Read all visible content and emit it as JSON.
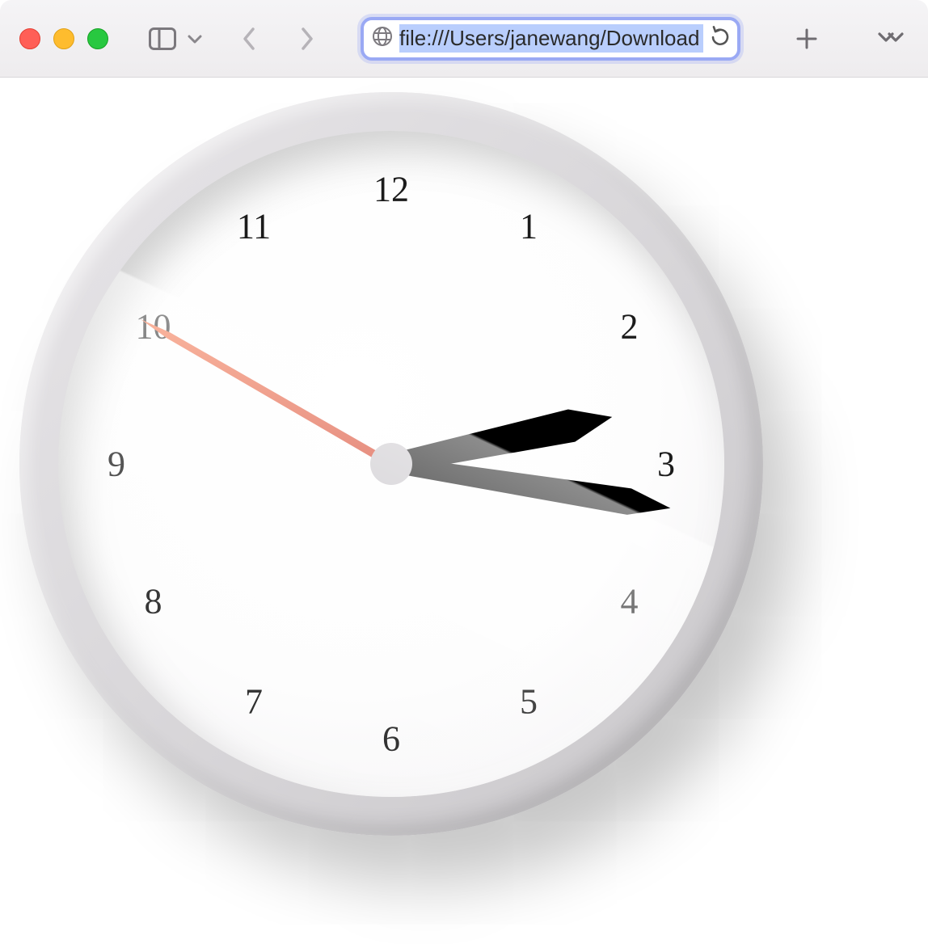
{
  "browser": {
    "url": "file:///Users/janewang/Download",
    "window_controls": {
      "close": "close",
      "minimize": "minimize",
      "zoom": "zoom"
    }
  },
  "clock": {
    "numerals": [
      "12",
      "1",
      "2",
      "3",
      "4",
      "5",
      "6",
      "7",
      "8",
      "9",
      "10",
      "11"
    ],
    "time": {
      "hours": 2,
      "minutes": 13,
      "seconds": 50
    },
    "hands": {
      "hour_angle_deg": 78,
      "minute_angle_deg": 99,
      "second_angle_deg": 300
    },
    "colors": {
      "second_hand": "#e24a2a",
      "rim": "#d6d4d7",
      "face": "#ffffff"
    }
  }
}
